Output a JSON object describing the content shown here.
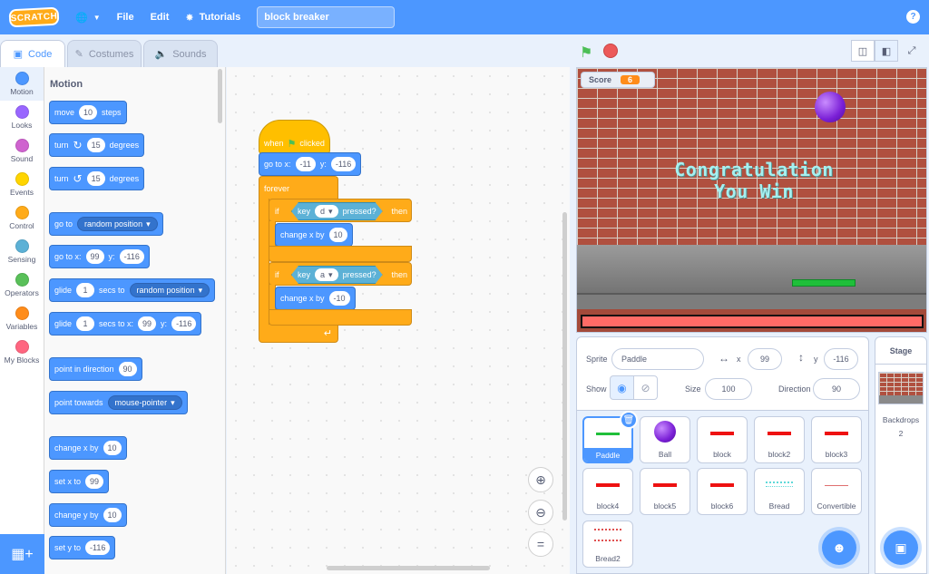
{
  "menubar": {
    "logo": "SCRATCH",
    "file": "File",
    "edit": "Edit",
    "tutorials": "Tutorials",
    "project_title": "block breaker",
    "help": "?"
  },
  "tabs": {
    "code": "Code",
    "costumes": "Costumes",
    "sounds": "Sounds"
  },
  "categories": [
    {
      "label": "Motion",
      "color": "#4c97ff"
    },
    {
      "label": "Looks",
      "color": "#9966ff"
    },
    {
      "label": "Sound",
      "color": "#cf63cf"
    },
    {
      "label": "Events",
      "color": "#ffd500"
    },
    {
      "label": "Control",
      "color": "#ffab19"
    },
    {
      "label": "Sensing",
      "color": "#5cb1d6"
    },
    {
      "label": "Operators",
      "color": "#59c059"
    },
    {
      "label": "Variables",
      "color": "#ff8c1a"
    },
    {
      "label": "My Blocks",
      "color": "#ff6680"
    }
  ],
  "palette": {
    "title": "Motion",
    "move": {
      "pre": "move",
      "val": "10",
      "post": "steps"
    },
    "turn_right": {
      "pre": "turn",
      "val": "15",
      "post": "degrees"
    },
    "turn_left": {
      "pre": "turn",
      "val": "15",
      "post": "degrees"
    },
    "goto": {
      "pre": "go to",
      "dd": "random position"
    },
    "goto_xy": {
      "pre": "go to x:",
      "x": "99",
      "ylab": "y:",
      "y": "-116"
    },
    "glide": {
      "pre": "glide",
      "val": "1",
      "mid": "secs to",
      "dd": "random position"
    },
    "glide_xy": {
      "pre": "glide",
      "val": "1",
      "mid": "secs to x:",
      "x": "99",
      "ylab": "y:",
      "y": "-116"
    },
    "point_dir": {
      "pre": "point in direction",
      "val": "90"
    },
    "point_towards": {
      "pre": "point towards",
      "dd": "mouse-pointer"
    },
    "change_x": {
      "pre": "change x by",
      "val": "10"
    },
    "set_x": {
      "pre": "set x to",
      "val": "99"
    },
    "change_y": {
      "pre": "change y by",
      "val": "10"
    },
    "set_y": {
      "pre": "set y to",
      "val": "-116"
    }
  },
  "script": {
    "hat_when": "when",
    "hat_clicked": "clicked",
    "goto_label": "go to x:",
    "goto_x": "-11",
    "goto_ylabel": "y:",
    "goto_y": "-116",
    "forever": "forever",
    "if1": {
      "if": "if",
      "key": "key",
      "key_val": "d",
      "pressed": "pressed?",
      "then": "then",
      "action": "change x by",
      "action_val": "10"
    },
    "if2": {
      "if": "if",
      "key": "key",
      "key_val": "a",
      "pressed": "pressed?",
      "then": "then",
      "action": "change x by",
      "action_val": "-10"
    }
  },
  "stage": {
    "score_label": "Score",
    "score_value": "6",
    "message_line1": "Congratulation",
    "message_line2": "You Win"
  },
  "sprite_info": {
    "sprite_label": "Sprite",
    "sprite_name": "Paddle",
    "x_label": "x",
    "x_value": "99",
    "y_label": "y",
    "y_value": "-116",
    "show_label": "Show",
    "size_label": "Size",
    "size_value": "100",
    "direction_label": "Direction",
    "direction_value": "90"
  },
  "sprites": [
    {
      "name": "Paddle",
      "selected": true
    },
    {
      "name": "Ball"
    },
    {
      "name": "block"
    },
    {
      "name": "block2"
    },
    {
      "name": "block3"
    },
    {
      "name": "block4"
    },
    {
      "name": "block5"
    },
    {
      "name": "block6"
    },
    {
      "name": "Bread"
    },
    {
      "name": "Convertible"
    },
    {
      "name": "Bread2"
    }
  ],
  "stage_panel": {
    "title": "Stage",
    "backdrops_label": "Backdrops",
    "backdrops_count": "2"
  }
}
